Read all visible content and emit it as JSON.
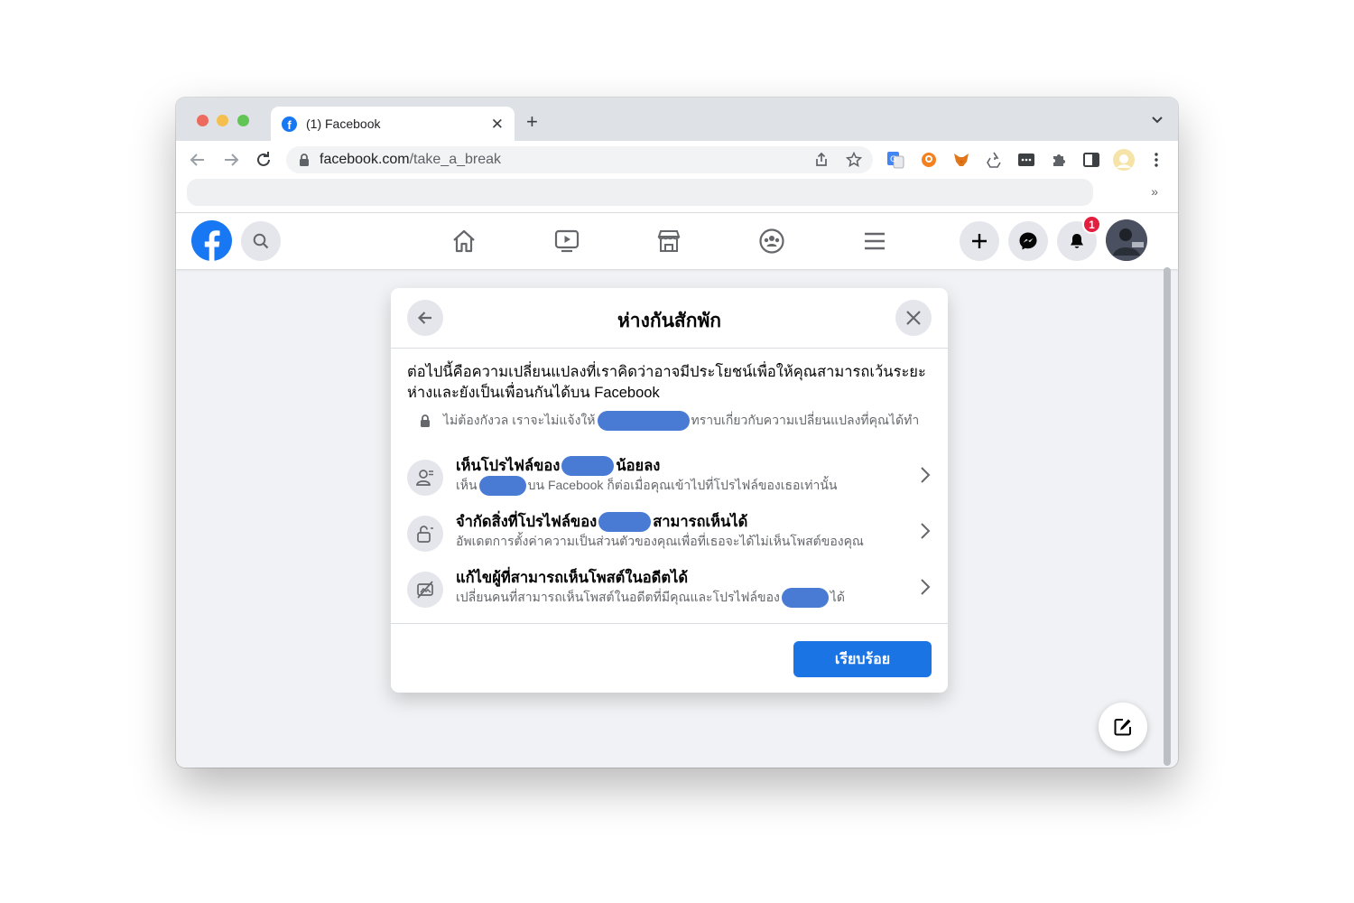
{
  "browser": {
    "tab": {
      "title": "(1) Facebook",
      "close": "✕"
    },
    "new_tab": "+",
    "url": {
      "domain": "facebook.com",
      "path": "/take_a_break"
    },
    "bookmarks_more": "»"
  },
  "facebook_nav": {
    "icons": [
      "search-icon",
      "home-icon",
      "watch-icon",
      "marketplace-icon",
      "groups-icon",
      "menu-icon",
      "create-icon",
      "messenger-icon",
      "notifications-icon"
    ],
    "notification_count": "1",
    "accent": "#1877f2"
  },
  "modal": {
    "title": "ห่างกันสักพัก",
    "intro": "ต่อไปนี้คือความเปลี่ยนแปลงที่เราคิดว่าอาจมีประโยชน์เพื่อให้คุณสามารถเว้นระยะห่างและยังเป็นเพื่อนกันได้บน Facebook",
    "notice_before": "ไม่ต้องกังวล เราจะไม่แจ้งให้",
    "notice_after": "ทราบเกี่ยวกับความเปลี่ยนแปลงที่คุณได้ทำ",
    "options": [
      {
        "title_before": "เห็นโปรไฟล์ของ",
        "title_after": "น้อยลง",
        "sub_before": "เห็น",
        "sub_after": "บน Facebook ก็ต่อเมื่อคุณเข้าไปที่โปรไฟล์ของเธอเท่านั้น"
      },
      {
        "title_before": "จำกัดสิ่งที่โปรไฟล์ของ",
        "title_after": "สามารถเห็นได้",
        "sub_before": "อัพเดตการตั้งค่าความเป็นส่วนตัวของคุณเพื่อที่เธอจะได้ไม่เห็นโพสต์ของคุณ",
        "sub_after": ""
      },
      {
        "title_before": "แก้ไขผู้ที่สามารถเห็นโพสต์ในอดีตได้",
        "title_after": "",
        "sub_before": "เปลี่ยนคนที่สามารถเห็นโพสต์ในอดีตที่มีคุณและโปรไฟล์ของ",
        "sub_after": "ได้"
      }
    ],
    "done_label": "เรียบร้อย",
    "redaction_color": "#4a7bd4",
    "button_color": "#1b74e4"
  }
}
